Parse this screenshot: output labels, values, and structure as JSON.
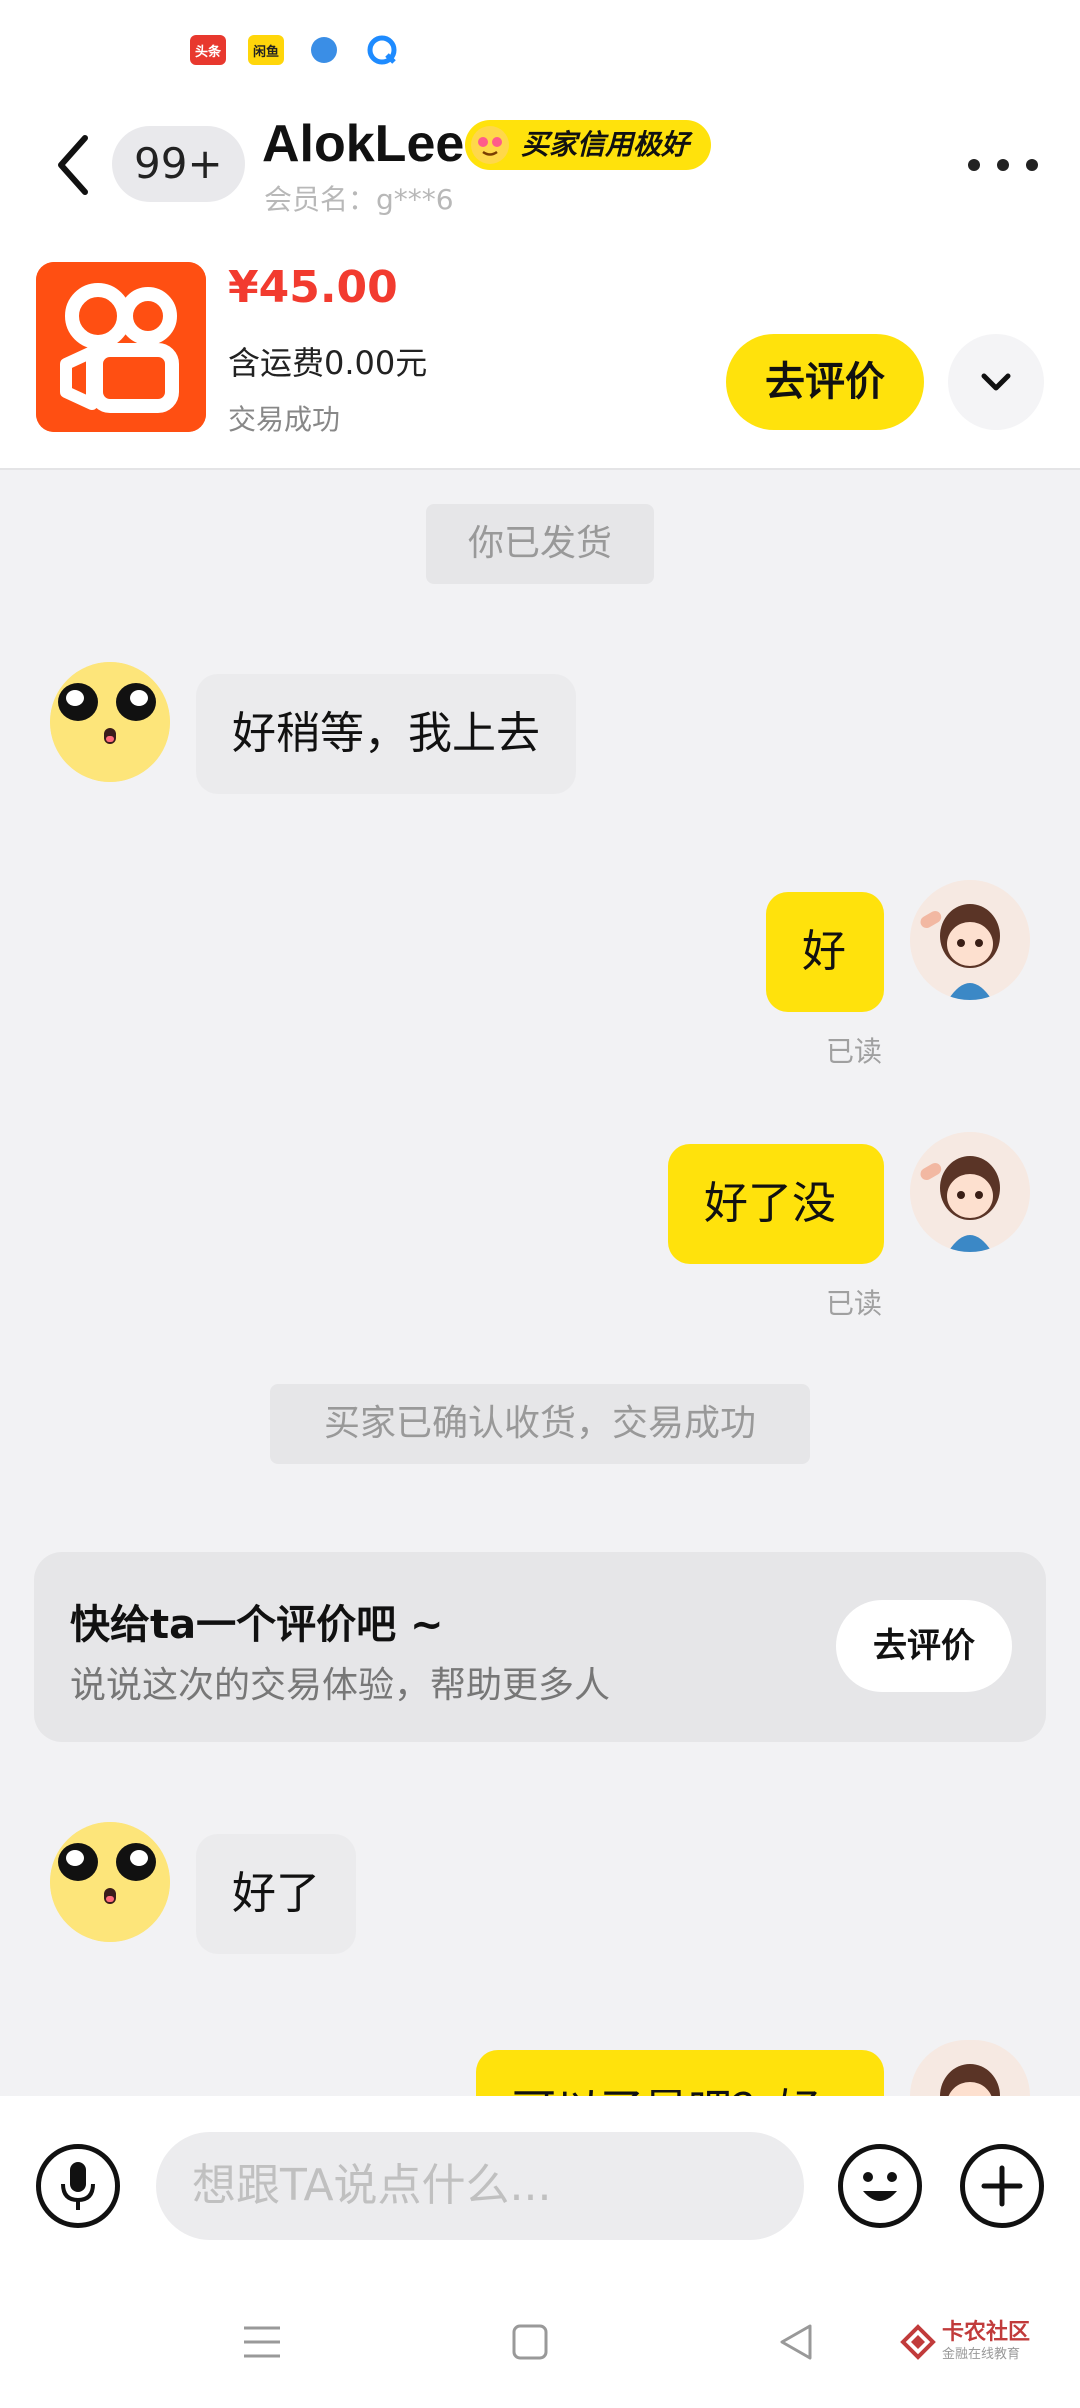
{
  "status_bar": {
    "app_icons": [
      {
        "name": "toutiao-icon",
        "label": "头条",
        "color": "#e8382e"
      },
      {
        "name": "xianyu-icon",
        "label": "闲鱼",
        "color": "#ffd60a"
      },
      {
        "name": "compass-icon",
        "label": "",
        "color": "#3a8ee6"
      },
      {
        "name": "qq-browser-icon",
        "label": "",
        "color": "#1e8bff"
      }
    ]
  },
  "header": {
    "unread_badge": "99+",
    "username": "AlokLee",
    "credit_badge": "买家信用极好",
    "member_label": "会员名：g***6"
  },
  "order": {
    "price": "¥45.00",
    "shipping": "含运费0.00元",
    "status": "交易成功",
    "review_button": "去评价"
  },
  "messages": {
    "shipped": "你已发货",
    "m1": "好稍等，我上去",
    "m2": "好",
    "m2_read": "已读",
    "m3": "好了没",
    "m3_read": "已读",
    "confirmed": "买家已确认收货，交易成功",
    "m4": "好了",
    "m5_partial": "可以了是吧？好"
  },
  "review_card": {
    "title": "快给ta一个评价吧 ~",
    "subtitle": "说说这次的交易体验，帮助更多人",
    "button": "去评价"
  },
  "input": {
    "placeholder": "想跟TA说点什么..."
  },
  "watermark": {
    "title": "卡农社区",
    "subtitle": "金融在线教育"
  },
  "colors": {
    "accent_yellow": "#ffe20c",
    "price_red": "#f23b2f",
    "background": "#f2f2f4"
  }
}
